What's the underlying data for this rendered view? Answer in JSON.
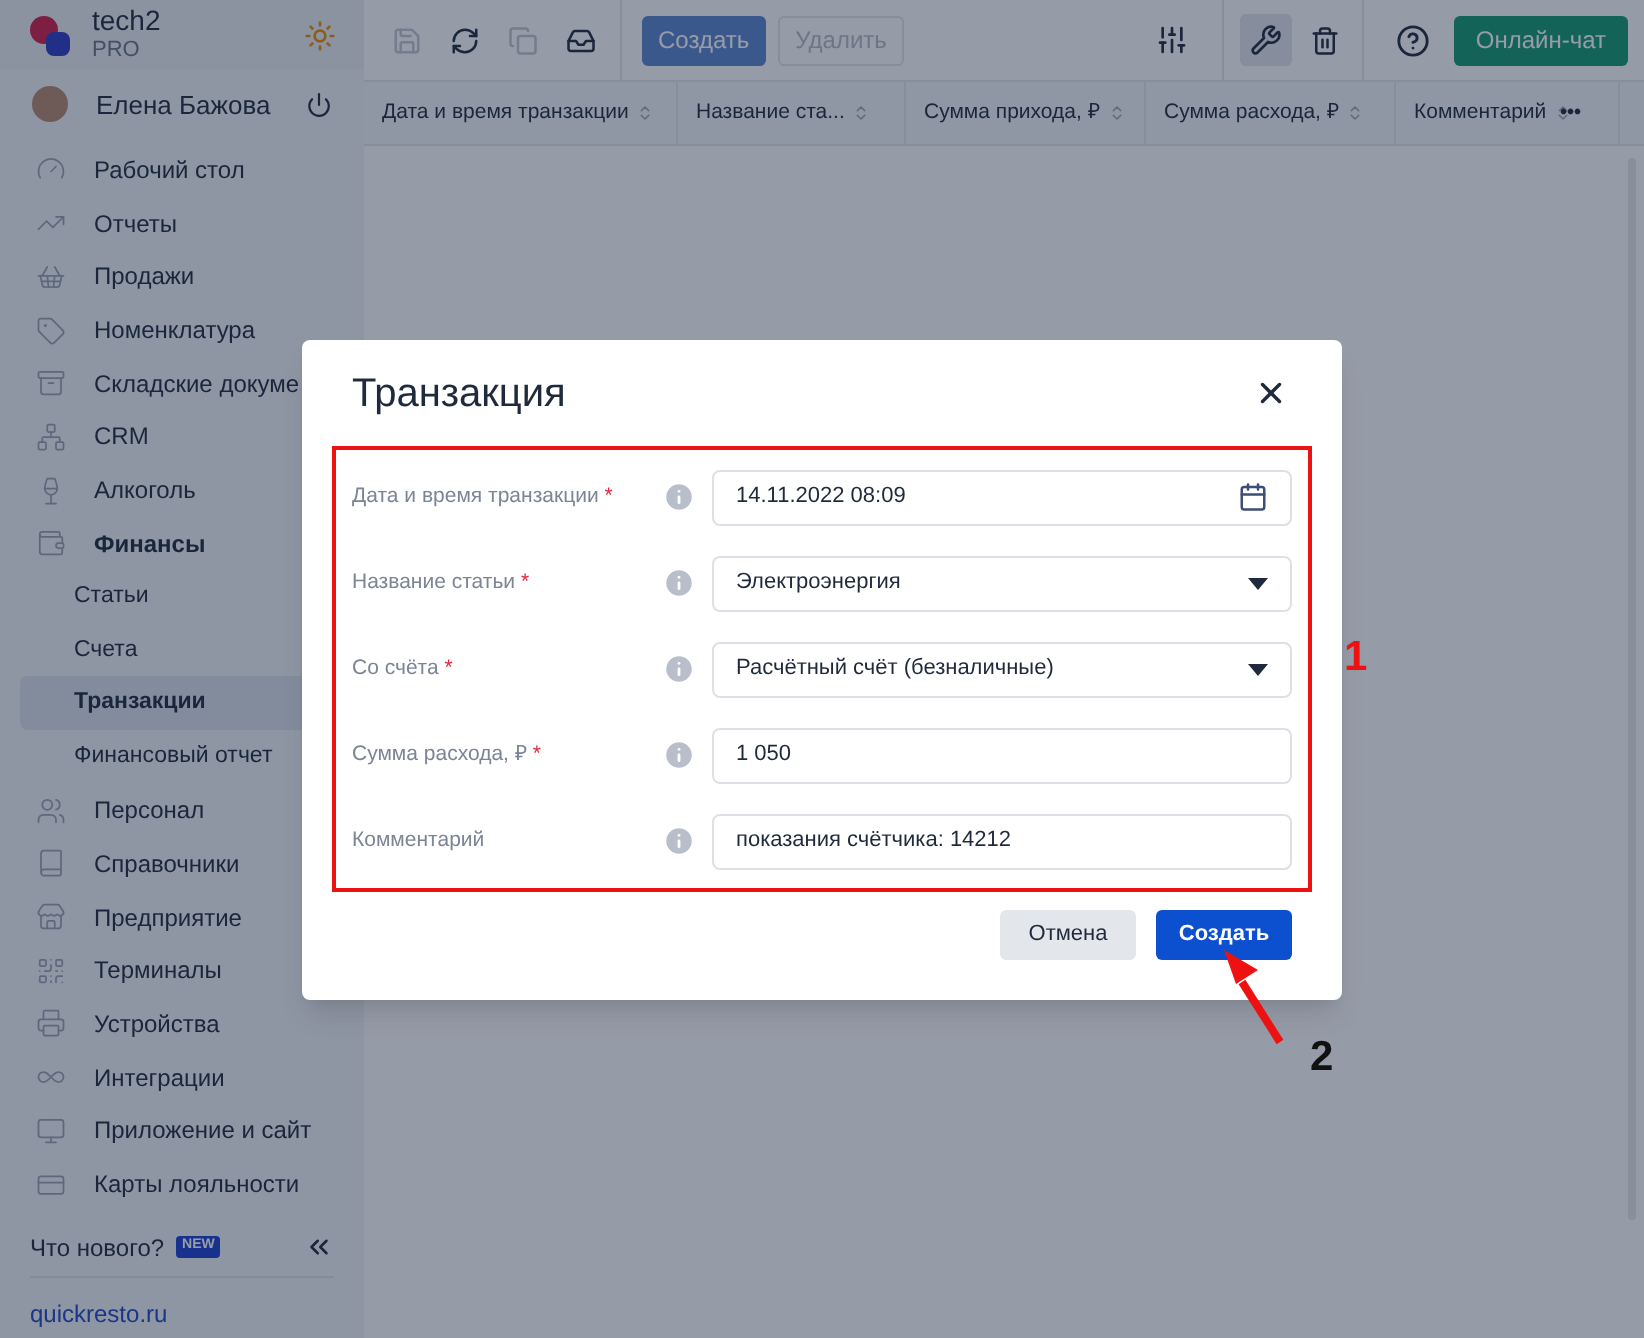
{
  "brand": {
    "name": "tech2",
    "plan": "PRO"
  },
  "user": {
    "name": "Елена Бажова"
  },
  "sidebar": {
    "items": [
      {
        "kind": "section",
        "label": "Рабочий стол",
        "expanded": false
      },
      {
        "kind": "section",
        "label": "Отчеты",
        "expanded": false
      },
      {
        "kind": "section",
        "label": "Продажи",
        "expanded": false
      },
      {
        "kind": "section",
        "label": "Номенклатура",
        "expanded": false
      },
      {
        "kind": "section",
        "label": "Складские докуме",
        "expanded": false
      },
      {
        "kind": "section",
        "label": "CRM",
        "expanded": false
      },
      {
        "kind": "section",
        "label": "Алкоголь",
        "expanded": false
      },
      {
        "kind": "section",
        "label": "Финансы",
        "expanded": true
      },
      {
        "kind": "sub",
        "label": "Статьи",
        "selected": false
      },
      {
        "kind": "sub",
        "label": "Счета",
        "selected": false
      },
      {
        "kind": "sub",
        "label": "Транзакции",
        "selected": true
      },
      {
        "kind": "sub",
        "label": "Финансовый отчет",
        "selected": false
      },
      {
        "kind": "section",
        "label": "Персонал",
        "expanded": false
      },
      {
        "kind": "section",
        "label": "Справочники",
        "expanded": false
      },
      {
        "kind": "section",
        "label": "Предприятие",
        "expanded": false
      },
      {
        "kind": "section",
        "label": "Терминалы",
        "expanded": false
      },
      {
        "kind": "section",
        "label": "Устройства",
        "expanded": false
      },
      {
        "kind": "section",
        "label": "Интеграции",
        "expanded": false
      },
      {
        "kind": "section",
        "label": "Приложение и сайт",
        "expanded": false
      },
      {
        "kind": "section",
        "label": "Карты лояльности",
        "expanded": false
      }
    ],
    "whats_new": "Что нового?",
    "new_badge": "NEW",
    "site_link": "quickresto.ru"
  },
  "toolbar": {
    "tools": [
      {
        "kind": "save",
        "disabled": true
      },
      {
        "kind": "refresh",
        "disabled": false
      },
      {
        "kind": "copy",
        "disabled": true
      },
      {
        "kind": "inbox",
        "disabled": false
      }
    ],
    "create": {
      "label": "Создать",
      "disabled": false
    },
    "delete": {
      "label": "Удалить",
      "disabled": true
    },
    "settings_active": false,
    "tools_active": true,
    "chat": "Онлайн-чат"
  },
  "table": {
    "columns": [
      "Дата и время транзакции",
      "Название ста...",
      "Сумма прихода, ₽",
      "Сумма расхода, ₽",
      "Комментарий"
    ],
    "more": "•••"
  },
  "dialog": {
    "title": "Транзакция",
    "fields": [
      {
        "kind": "date",
        "label": "Дата и время транзакции",
        "required_mark": "*",
        "value": "14.11.2022 08:09"
      },
      {
        "kind": "select",
        "label": "Название статьи",
        "required_mark": "*",
        "value": "Электроэнергия"
      },
      {
        "kind": "select",
        "label": "Со счёта",
        "required_mark": "*",
        "value": "Расчётный счёт (безналичные)"
      },
      {
        "kind": "text",
        "label": "Сумма расхода, ₽",
        "required_mark": "*",
        "value": "1 050"
      },
      {
        "kind": "text",
        "label": "Комментарий",
        "value": "показания счётчика: 14212"
      }
    ],
    "cancel": "Отмена",
    "submit": "Создать"
  },
  "annotations": [
    "1",
    "2"
  ]
}
